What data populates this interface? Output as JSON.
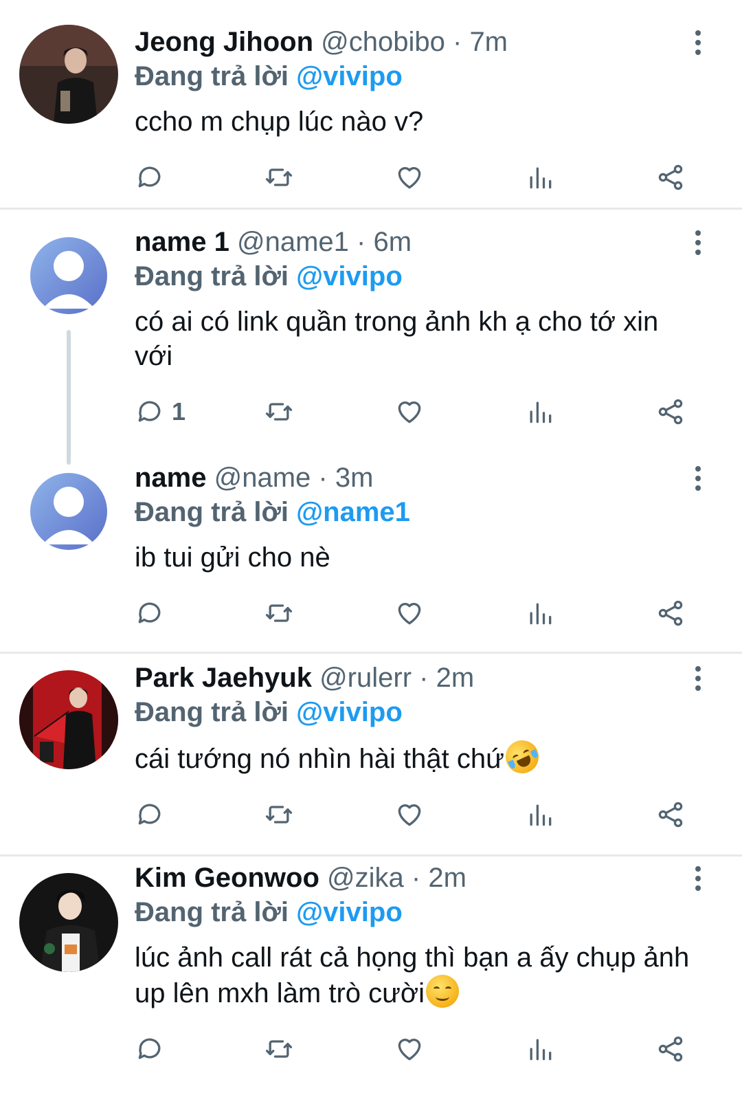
{
  "tweets": [
    {
      "name": "Jeong Jihoon",
      "handle": "@chobibo",
      "dot": "·",
      "time": "7m",
      "reply_prefix": "Đang trả lời",
      "reply_target": "@vivipo",
      "text": "ccho m chụp lúc nào v?",
      "reply_count": "",
      "avatar": "photo"
    },
    {
      "name": "name 1",
      "handle": "@name1",
      "dot": "·",
      "time": "6m",
      "reply_prefix": "Đang trả lời",
      "reply_target": "@vivipo",
      "text": "có ai có link quần trong ảnh kh ạ cho tớ xin với",
      "reply_count": "1",
      "avatar": "default"
    },
    {
      "name": "name",
      "handle": "@name",
      "dot": "·",
      "time": "3m",
      "reply_prefix": "Đang trả lời",
      "reply_target": "@name1",
      "text": "ib tui gửi cho nè",
      "reply_count": "",
      "avatar": "default"
    },
    {
      "name": "Park Jaehyuk",
      "handle": "@rulerr",
      "dot": "·",
      "time": "2m",
      "reply_prefix": "Đang trả lời",
      "reply_target": "@vivipo",
      "text": "cái tướng nó nhìn hài thật chứ",
      "emoji": "rolling-on-floor-laughing",
      "reply_count": "",
      "avatar": "photo"
    },
    {
      "name": "Kim Geonwoo",
      "handle": "@zika",
      "dot": "·",
      "time": "2m",
      "reply_prefix": "Đang trả lời",
      "reply_target": "@vivipo",
      "text": "lúc ảnh call rát cả họng thì bạn a ấy chụp ảnh up lên mxh làm trò cười",
      "emoji": "smiling-face",
      "reply_count": "",
      "avatar": "photo"
    }
  ],
  "icons": [
    "reply-icon",
    "retweet-icon",
    "like-icon",
    "views-icon",
    "share-icon",
    "more-icon"
  ],
  "colors": {
    "accent": "#1d9bf0",
    "muted": "#536471",
    "text": "#0f1419",
    "divider": "#e7e9ea"
  }
}
